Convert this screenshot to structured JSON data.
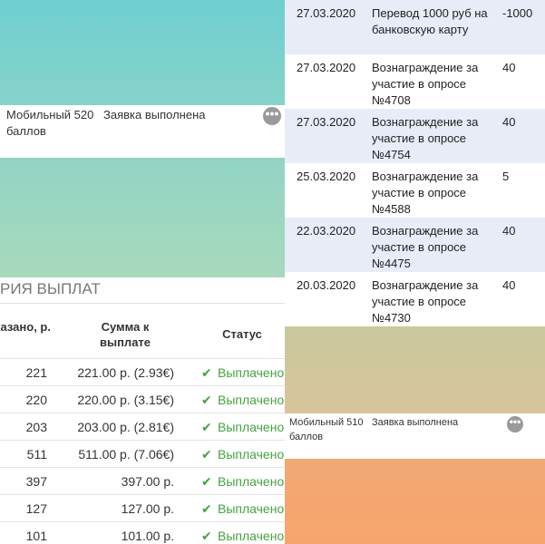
{
  "left_order": {
    "name": "Мобильный 520 баллов",
    "status": "Заявка выполнена",
    "more_glyph": "•••"
  },
  "payout_history": {
    "title": "РИЯ ВЫПЛАТ",
    "headers": {
      "ordered": "казано, р.",
      "sum": "Сумма к выплате",
      "status": "Статус"
    },
    "status_icon": "check-icon",
    "rows": [
      {
        "ordered": "221",
        "sum": "221.00 р. (2.93€)",
        "status": "Выплачено"
      },
      {
        "ordered": "220",
        "sum": "220.00 р. (3.15€)",
        "status": "Выплачено"
      },
      {
        "ordered": "203",
        "sum": "203.00 р. (2.81€)",
        "status": "Выплачено"
      },
      {
        "ordered": "511",
        "sum": "511.00 р. (7.06€)",
        "status": "Выплачено"
      },
      {
        "ordered": "397",
        "sum": "397.00 р.",
        "status": "Выплачено"
      },
      {
        "ordered": "127",
        "sum": "127.00 р.",
        "status": "Выплачено"
      },
      {
        "ordered": "101",
        "sum": "101.00 р.",
        "status": "Выплачено"
      }
    ]
  },
  "transactions": [
    {
      "date": "27.03.2020",
      "description": "Перевод 1000 руб на банковскую карту",
      "amount": "-1000"
    },
    {
      "date": "27.03.2020",
      "description": "Вознаграждение за участие в опросе №4708",
      "amount": "40"
    },
    {
      "date": "27.03.2020",
      "description": "Вознаграждение за участие в опросе №4754",
      "amount": "40"
    },
    {
      "date": "25.03.2020",
      "description": "Вознаграждение за участие в опросе №4588",
      "amount": "5"
    },
    {
      "date": "22.03.2020",
      "description": "Вознаграждение за участие в опросе №4475",
      "amount": "40"
    },
    {
      "date": "20.03.2020",
      "description": "Вознаграждение за участие в опросе №4730",
      "amount": "40"
    }
  ],
  "right_order": {
    "name": "Мобильный 510 баллов",
    "status": "Заявка выполнена",
    "more_glyph": "•••"
  },
  "colors": {
    "teal_banner": "#6fcfd1",
    "mint_banner": "#a8d9bc",
    "olive_banner": "#c9c99d",
    "orange_banner": "#f7a56d",
    "paid_green": "#45a241",
    "row_shade": "#e7ecf6"
  }
}
